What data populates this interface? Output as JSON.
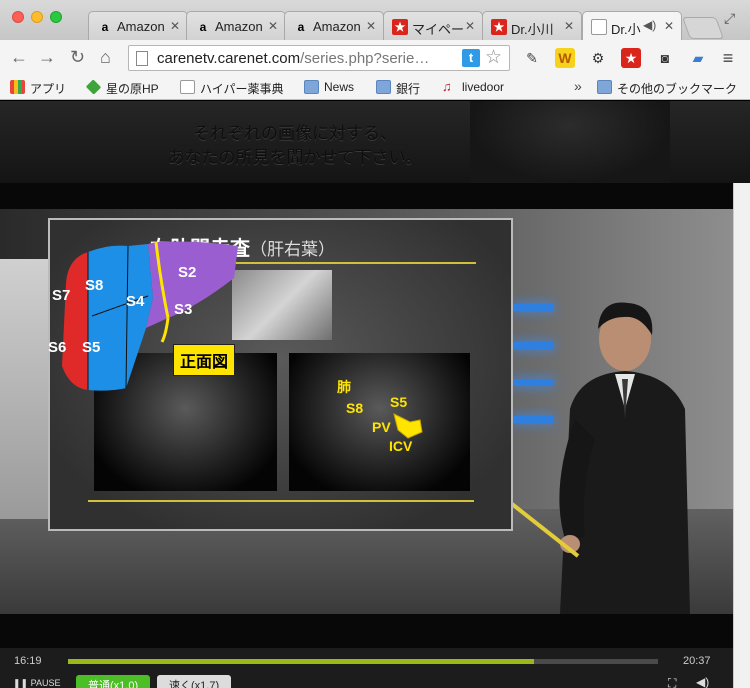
{
  "tabs": [
    {
      "label": "Amazon",
      "icon": "amazon-icon"
    },
    {
      "label": "Amazon",
      "icon": "amazon-icon"
    },
    {
      "label": "Amazon",
      "icon": "amazon-icon"
    },
    {
      "label": "マイペー",
      "icon": "red-star-icon"
    },
    {
      "label": "Dr.小川",
      "icon": "red-star-icon"
    },
    {
      "label": "Dr.小",
      "icon": "page-icon",
      "active": true
    }
  ],
  "toolbar": {
    "url_host": "carenetv.carenet.com",
    "url_rest": "/series.php?serie…"
  },
  "bookmarks": [
    {
      "label": "アプリ",
      "icon": "apps-icon"
    },
    {
      "label": "星の原HP",
      "icon": "green-diamond-icon"
    },
    {
      "label": "ハイパー薬事典",
      "icon": "page-icon"
    },
    {
      "label": "News",
      "icon": "folder-icon"
    },
    {
      "label": "銀行",
      "icon": "folder-icon"
    },
    {
      "label": "livedoor",
      "icon": "livedoor-icon"
    },
    {
      "label": "その他のブックマーク",
      "icon": "folder-icon"
    }
  ],
  "banner": {
    "line1": "それぞれの画像に対する、",
    "line2": "あなたの所見を聞かせて下さい。"
  },
  "slide": {
    "title_main": "右肋間走査",
    "title_sub": "（肝右葉）",
    "badge": "正面図",
    "segments": [
      "S2",
      "S3",
      "S4",
      "S5",
      "S6",
      "S7",
      "S8"
    ],
    "us_labels": {
      "lung": "肺",
      "s8": "S8",
      "s5": "S5",
      "pv": "PV",
      "icv": "ICV"
    }
  },
  "player": {
    "elapsed": "16:19",
    "total": "20:37",
    "progress": 0.79,
    "pause_label": "PAUSE",
    "speed_normal": "普通(x1.0)",
    "speed_fast": "速く(x1.7)"
  },
  "colors": {
    "accent_green": "#4cbf27",
    "progress": "#9bb81a",
    "label_yellow": "#ffe400"
  }
}
